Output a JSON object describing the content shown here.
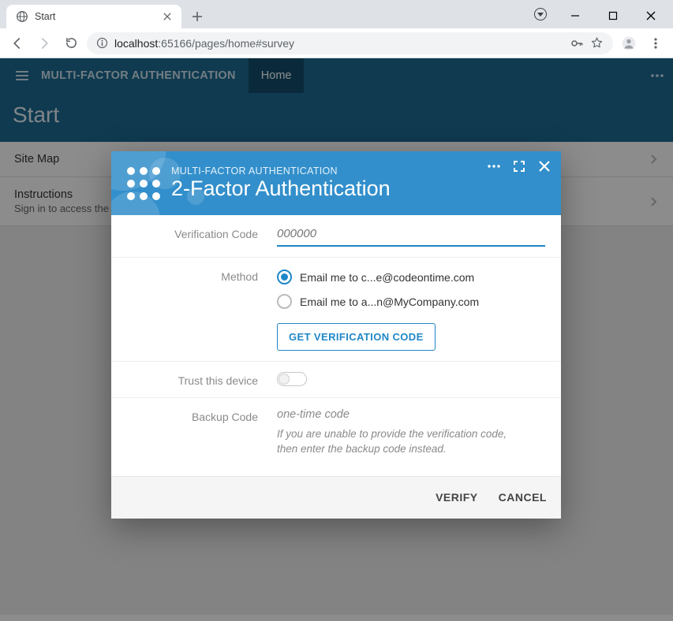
{
  "browser": {
    "tab_title": "Start",
    "url_host": "localhost",
    "url_port": ":65166",
    "url_path": "/pages/home#survey"
  },
  "app": {
    "name": "MULTI-FACTOR AUTHENTICATION",
    "nav_home": "Home",
    "page_title": "Start"
  },
  "list": {
    "sitemap": "Site Map",
    "instructions_title": "Instructions",
    "instructions_sub": "Sign in to access the p"
  },
  "modal": {
    "eyebrow": "MULTI-FACTOR AUTHENTICATION",
    "headline": "2-Factor Authentication",
    "labels": {
      "verification_code": "Verification Code",
      "method": "Method",
      "trust": "Trust this device",
      "backup": "Backup Code"
    },
    "verification_placeholder": "000000",
    "methods": [
      "Email me to c...e@codeontime.com",
      "Email me to a...n@MyCompany.com"
    ],
    "get_code": "GET VERIFICATION CODE",
    "backup_placeholder": "one-time code",
    "backup_hint": "If you are unable to provide the verification code, then enter the backup code instead.",
    "verify": "VERIFY",
    "cancel": "CANCEL"
  }
}
